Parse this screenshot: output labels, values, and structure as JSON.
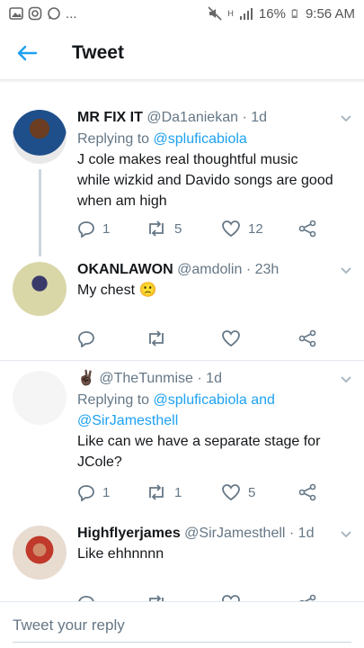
{
  "status_bar": {
    "dots": "...",
    "battery_percent": "16%",
    "time": "9:56 AM",
    "network": "H"
  },
  "app_bar": {
    "title": "Tweet"
  },
  "tweets": [
    {
      "name": "MR FIX IT",
      "handle": "@Da1aniekan",
      "time": "· 1d",
      "replying_label": "Replying to",
      "replying_to": [
        "@spluficabiola"
      ],
      "text_lines": [
        "J cole makes real thoughtful music",
        "while wizkid and Davido songs are good",
        "when am high"
      ],
      "replies": "1",
      "retweets": "5",
      "likes": "12"
    },
    {
      "name": "OKANLAWON",
      "handle": "@amdolin",
      "time": "· 23h",
      "text": "My chest 🙁",
      "replies": "",
      "retweets": "",
      "likes": ""
    },
    {
      "name": "✌🏿",
      "handle": "@TheTunmise",
      "time": "· 1d",
      "replying_label": "Replying to",
      "replying_to": [
        "@spluficabiola",
        "and",
        "@SirJamesthell"
      ],
      "text_lines": [
        "Like can we have a separate stage for",
        "JCole?"
      ],
      "replies": "1",
      "retweets": "1",
      "likes": "5"
    },
    {
      "name": "Highflyerjames",
      "handle": "@SirJamesthell",
      "time": "· 1d",
      "text": "Like ehhnnnn"
    }
  ],
  "reply_bar": {
    "placeholder": "Tweet your reply"
  },
  "colors": {
    "accent": "#1da1f2",
    "secondary_text": "#657786",
    "divider": "#e1e8ed"
  }
}
